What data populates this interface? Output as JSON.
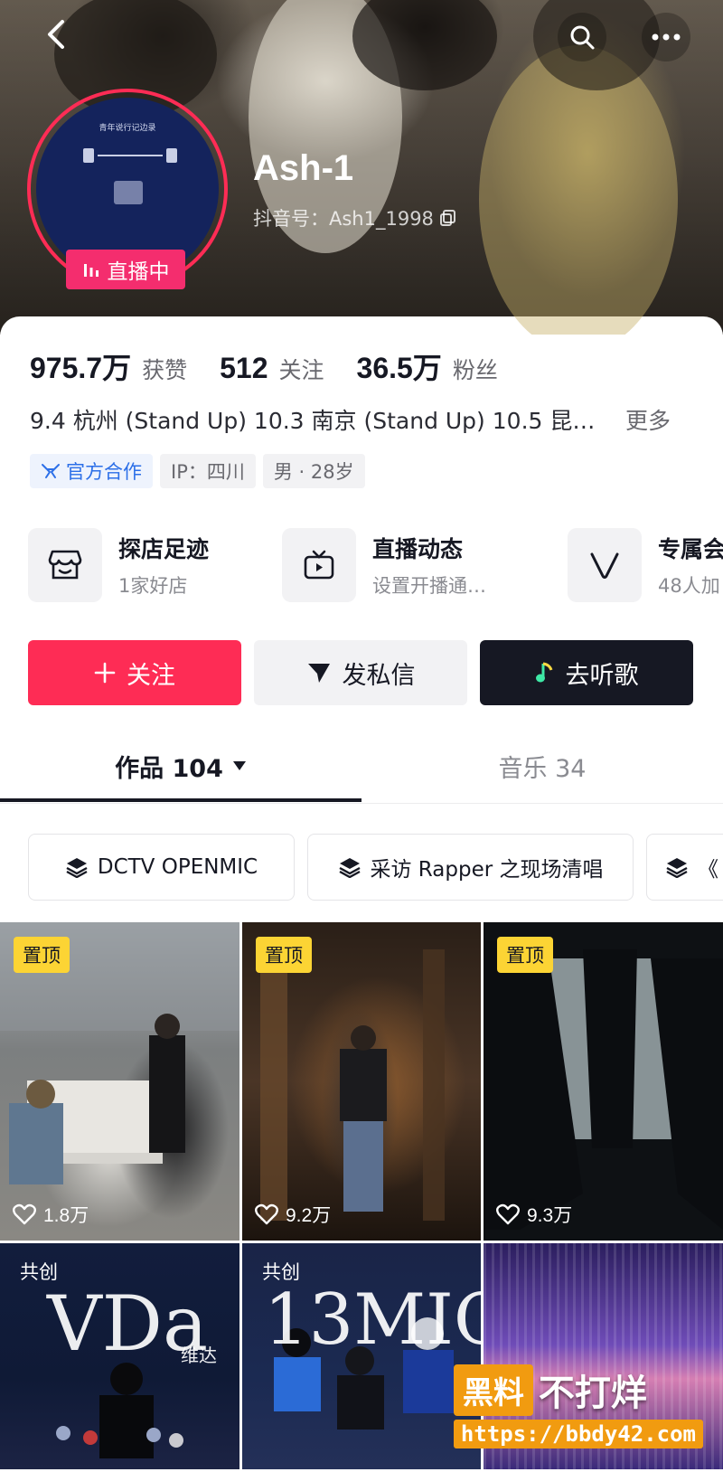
{
  "header": {
    "username": "Ash-1",
    "douyin_id": "抖音号：Ash1_1998",
    "live_badge": "直播中",
    "avatar_caption": "青年说行记边录"
  },
  "stats": [
    {
      "value": "975.7万",
      "label": "获赞"
    },
    {
      "value": "512",
      "label": "关注"
    },
    {
      "value": "36.5万",
      "label": "粉丝"
    }
  ],
  "bio": {
    "text": "9.4 杭州 (Stand Up) 10.3 南京 (Stand Up) 10.5 昆…",
    "more": "更多"
  },
  "tags": {
    "official": "官方合作",
    "ip": "IP：四川",
    "gender_age": "男 · 28岁"
  },
  "features": [
    {
      "title": "探店足迹",
      "subtitle": "1家好店",
      "icon": "shop-icon"
    },
    {
      "title": "直播动态",
      "subtitle": "设置开播通…",
      "icon": "tv-icon"
    },
    {
      "title": "专属会",
      "subtitle": "48人加",
      "icon": "v-icon"
    }
  ],
  "actions": {
    "follow": "关注",
    "message": "发私信",
    "listen": "去听歌"
  },
  "tabs": {
    "works": "作品 104",
    "music": "音乐 34"
  },
  "collections": [
    "DCTV OPENMIC",
    "采访 Rapper 之现场清唱",
    "《"
  ],
  "videos": [
    {
      "badge": "置顶",
      "likes": "1.8万"
    },
    {
      "badge": "置顶",
      "likes": "9.2万"
    },
    {
      "badge": "置顶",
      "likes": "9.3万"
    },
    {
      "badge": "共创",
      "script": "VDa",
      "sub": "维达"
    },
    {
      "badge": "共创",
      "script": "13MIC"
    },
    {
      "badge": ""
    }
  ],
  "watermark": {
    "box": "黑料",
    "text": "不打烊",
    "url": "https://bbdy42.com"
  },
  "colors": {
    "accent": "#fe2c55",
    "live": "#f42d6e",
    "pin": "#fcd434",
    "official": "#2c6fe8"
  }
}
